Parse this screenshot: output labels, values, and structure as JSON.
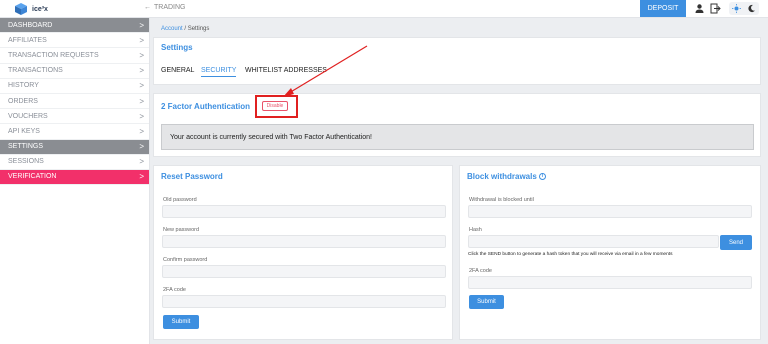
{
  "header": {
    "logo_text": "ice³x",
    "back_arrow": "←",
    "section": "TRADING",
    "deposit_label": "DEPOSIT"
  },
  "sidebar": {
    "items": [
      {
        "label": "DASHBOARD",
        "chevron": ">"
      },
      {
        "label": "AFFILIATES",
        "chevron": ">"
      },
      {
        "label": "TRANSACTION REQUESTS",
        "chevron": ">"
      },
      {
        "label": "TRANSACTIONS",
        "chevron": ">"
      },
      {
        "label": "HISTORY",
        "chevron": ">"
      },
      {
        "label": "ORDERS",
        "chevron": ">"
      },
      {
        "label": "VOUCHERS",
        "chevron": ">"
      },
      {
        "label": "API KEYS",
        "chevron": ">"
      },
      {
        "label": "SETTINGS",
        "chevron": ">"
      },
      {
        "label": "SESSIONS",
        "chevron": ">"
      },
      {
        "label": "VERIFICATION",
        "chevron": ">"
      }
    ]
  },
  "breadcrumb": {
    "home": "Account",
    "sep": "/",
    "current": "Settings"
  },
  "settings": {
    "title": "Settings",
    "tabs": [
      "GENERAL",
      "SECURITY",
      "WHITELIST ADDRESSES"
    ]
  },
  "twofa": {
    "title": "2 Factor Authentication",
    "disable_label": "Disable",
    "message": "Your account is currently secured with Two Factor Authentication!"
  },
  "reset_password": {
    "title": "Reset Password",
    "old_label": "Old password",
    "new_label": "New password",
    "confirm_label": "Confirm password",
    "code_label": "2FA code",
    "submit_label": "Submit"
  },
  "block_withdrawals": {
    "title": "Block withdrawals",
    "info": "i",
    "until_label": "Withdrawal is blocked until",
    "hash_label": "Hash",
    "send_label": "Send",
    "hint": "Click the SEND button to generate a hash token that you will receive via email in a few moments",
    "code_label": "2FA code",
    "submit_label": "Submit"
  },
  "colors": {
    "accent": "#3d8fe0",
    "active_sidebar": "#8a8d92",
    "verification": "#f2306a",
    "annotation": "#e02020"
  }
}
